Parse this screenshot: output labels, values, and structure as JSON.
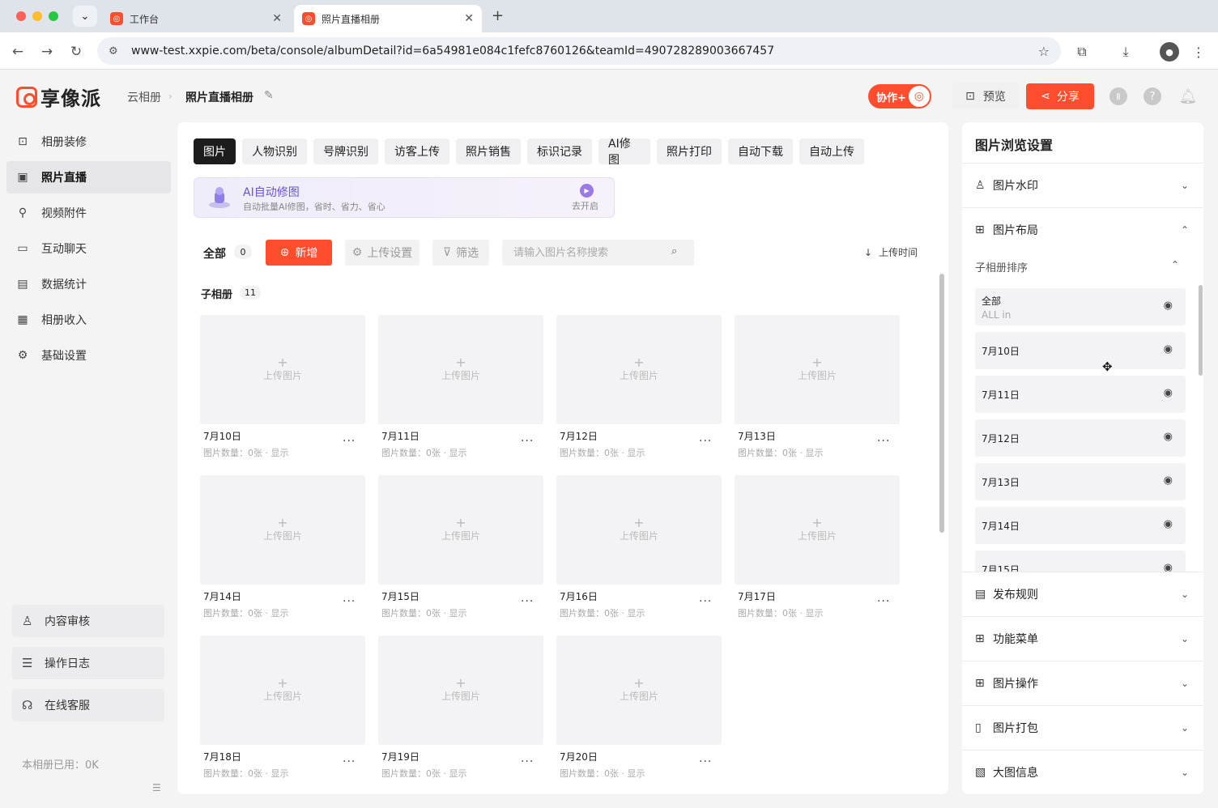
{
  "browser": {
    "tabs": [
      {
        "title": "工作台"
      },
      {
        "title": "照片直播相册"
      }
    ],
    "url": "www-test.xxpie.com/beta/console/albumDetail?id=6a54981e084c1fefc8760126&teamId=490728289003667457"
  },
  "header": {
    "logo_text": "享像派",
    "breadcrumb": [
      "云相册",
      "照片直播相册"
    ],
    "collab_label": "协作+",
    "preview_label": "预览",
    "share_label": "分享"
  },
  "sidebar": {
    "items": [
      {
        "label": "相册装修",
        "icon": "album-decor-icon"
      },
      {
        "label": "照片直播",
        "icon": "photo-live-icon"
      },
      {
        "label": "视频附件",
        "icon": "attachment-icon"
      },
      {
        "label": "互动聊天",
        "icon": "chat-icon"
      },
      {
        "label": "数据统计",
        "icon": "stats-icon"
      },
      {
        "label": "相册收入",
        "icon": "income-icon"
      },
      {
        "label": "基础设置",
        "icon": "settings-icon"
      }
    ],
    "bottom": [
      {
        "label": "内容审核"
      },
      {
        "label": "操作日志"
      },
      {
        "label": "在线客服"
      }
    ],
    "usage": "本相册已用：0K"
  },
  "main": {
    "tabs": [
      "图片",
      "人物识别",
      "号牌识别",
      "访客上传",
      "照片销售",
      "标识记录",
      "AI修图",
      "照片打印",
      "自动下载",
      "自动上传"
    ],
    "ai_banner": {
      "title": "AI自动修图",
      "desc": "自动批量AI修图，省时、省力、省心",
      "action": "去开启"
    },
    "toolbar": {
      "all_label": "全部",
      "all_count": "0",
      "add_label": "新增",
      "upload_settings": "上传设置",
      "filter": "筛选",
      "search_placeholder": "请输入图片名称搜索",
      "sort_label": "上传时间"
    },
    "sub_albums": {
      "title": "子相册",
      "count": "11",
      "upload_label": "上传图片",
      "items": [
        {
          "name": "7月10日",
          "meta": "图片数量：0张 · 显示"
        },
        {
          "name": "7月11日",
          "meta": "图片数量：0张 · 显示"
        },
        {
          "name": "7月12日",
          "meta": "图片数量：0张 · 显示"
        },
        {
          "name": "7月13日",
          "meta": "图片数量：0张 · 显示"
        },
        {
          "name": "7月14日",
          "meta": "图片数量：0张 · 显示"
        },
        {
          "name": "7月15日",
          "meta": "图片数量：0张 · 显示"
        },
        {
          "name": "7月16日",
          "meta": "图片数量：0张 · 显示"
        },
        {
          "name": "7月17日",
          "meta": "图片数量：0张 · 显示"
        },
        {
          "name": "7月18日",
          "meta": "图片数量：0张 · 显示"
        },
        {
          "name": "7月19日",
          "meta": "图片数量：0张 · 显示"
        },
        {
          "name": "7月20日",
          "meta": "图片数量：0张 · 显示"
        }
      ]
    }
  },
  "right_panel": {
    "title": "图片浏览设置",
    "sections": {
      "watermark": "图片水印",
      "layout": "图片布局",
      "sort_title": "子相册排序",
      "publish": "发布规则",
      "menu": "功能菜单",
      "operations": "图片操作",
      "package": "图片打包",
      "bigimage": "大图信息"
    },
    "sort_items": [
      {
        "name": "全部",
        "sub": "ALL in"
      },
      {
        "name": "7月10日"
      },
      {
        "name": "7月11日"
      },
      {
        "name": "7月12日"
      },
      {
        "name": "7月13日"
      },
      {
        "name": "7月14日"
      },
      {
        "name": "7月15日"
      }
    ]
  },
  "colors": {
    "accent": "#ff4d2d",
    "active_tab": "#1c1c1c",
    "ai_purple": "#6a54d8"
  }
}
